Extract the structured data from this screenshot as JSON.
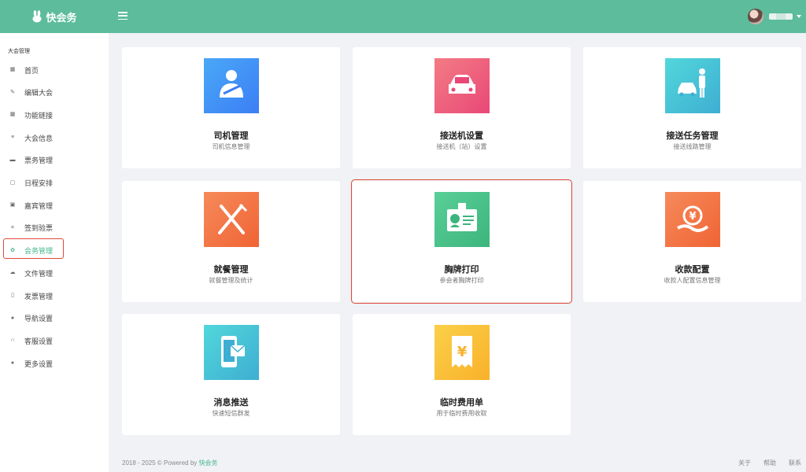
{
  "header": {
    "brand_name": "快会务",
    "brand_color": "#5cbc9c"
  },
  "sidebar": {
    "section_title": "大会管理",
    "items": [
      {
        "label": "首页",
        "icon": "dashboard-icon"
      },
      {
        "label": "编辑大会",
        "icon": "edit-icon"
      },
      {
        "label": "功能链接",
        "icon": "grid-icon"
      },
      {
        "label": "大会信息",
        "icon": "list-icon"
      },
      {
        "label": "票务管理",
        "icon": "ticket-icon"
      },
      {
        "label": "日程安排",
        "icon": "calendar-icon"
      },
      {
        "label": "嘉宾管理",
        "icon": "guest-icon"
      },
      {
        "label": "签到验票",
        "icon": "scan-icon"
      },
      {
        "label": "会务管理",
        "icon": "gear-icon"
      },
      {
        "label": "文件管理",
        "icon": "cloud-icon"
      },
      {
        "label": "发票管理",
        "icon": "document-icon"
      },
      {
        "label": "导航设置",
        "icon": "location-icon"
      },
      {
        "label": "客服设置",
        "icon": "headset-icon"
      },
      {
        "label": "更多设置",
        "icon": "more-icon"
      }
    ],
    "active_index": 8,
    "active_color": "#45b68b"
  },
  "cards": [
    {
      "title": "司机管理",
      "subtitle": "司机信息管理",
      "icon": "driver-icon",
      "colors": [
        "#4aa8f7",
        "#3b7ef5"
      ]
    },
    {
      "title": "接送机设置",
      "subtitle": "接送机（站）设置",
      "icon": "car-icon",
      "colors": [
        "#f37c84",
        "#e94877"
      ]
    },
    {
      "title": "接送任务管理",
      "subtitle": "接送线路管理",
      "icon": "car-person-icon",
      "colors": [
        "#52d7db",
        "#3eaed2"
      ]
    },
    {
      "title": "就餐管理",
      "subtitle": "就餐管理及统计",
      "icon": "fork-knife-icon",
      "colors": [
        "#f68a5a",
        "#f06435"
      ]
    },
    {
      "title": "胸牌打印",
      "subtitle": "参会者胸牌打印",
      "icon": "badge-icon",
      "colors": [
        "#5acf98",
        "#3cb57d"
      ]
    },
    {
      "title": "收款配置",
      "subtitle": "收款人配置信息管理",
      "icon": "yen-hand-icon",
      "colors": [
        "#f68a5a",
        "#f06435"
      ]
    },
    {
      "title": "消息推送",
      "subtitle": "快速短信群发",
      "icon": "phone-message-icon",
      "colors": [
        "#52d7db",
        "#3eaed2"
      ]
    },
    {
      "title": "临时费用单",
      "subtitle": "用于临时费用收取",
      "icon": "receipt-yen-icon",
      "colors": [
        "#fbd04a",
        "#f9b12a"
      ]
    }
  ],
  "highlight_card_index": 4,
  "footer": {
    "copyright": "2018 - 2025 © Powered by",
    "powered_by": "快会务",
    "links": [
      "关于",
      "帮助",
      "联系"
    ]
  }
}
